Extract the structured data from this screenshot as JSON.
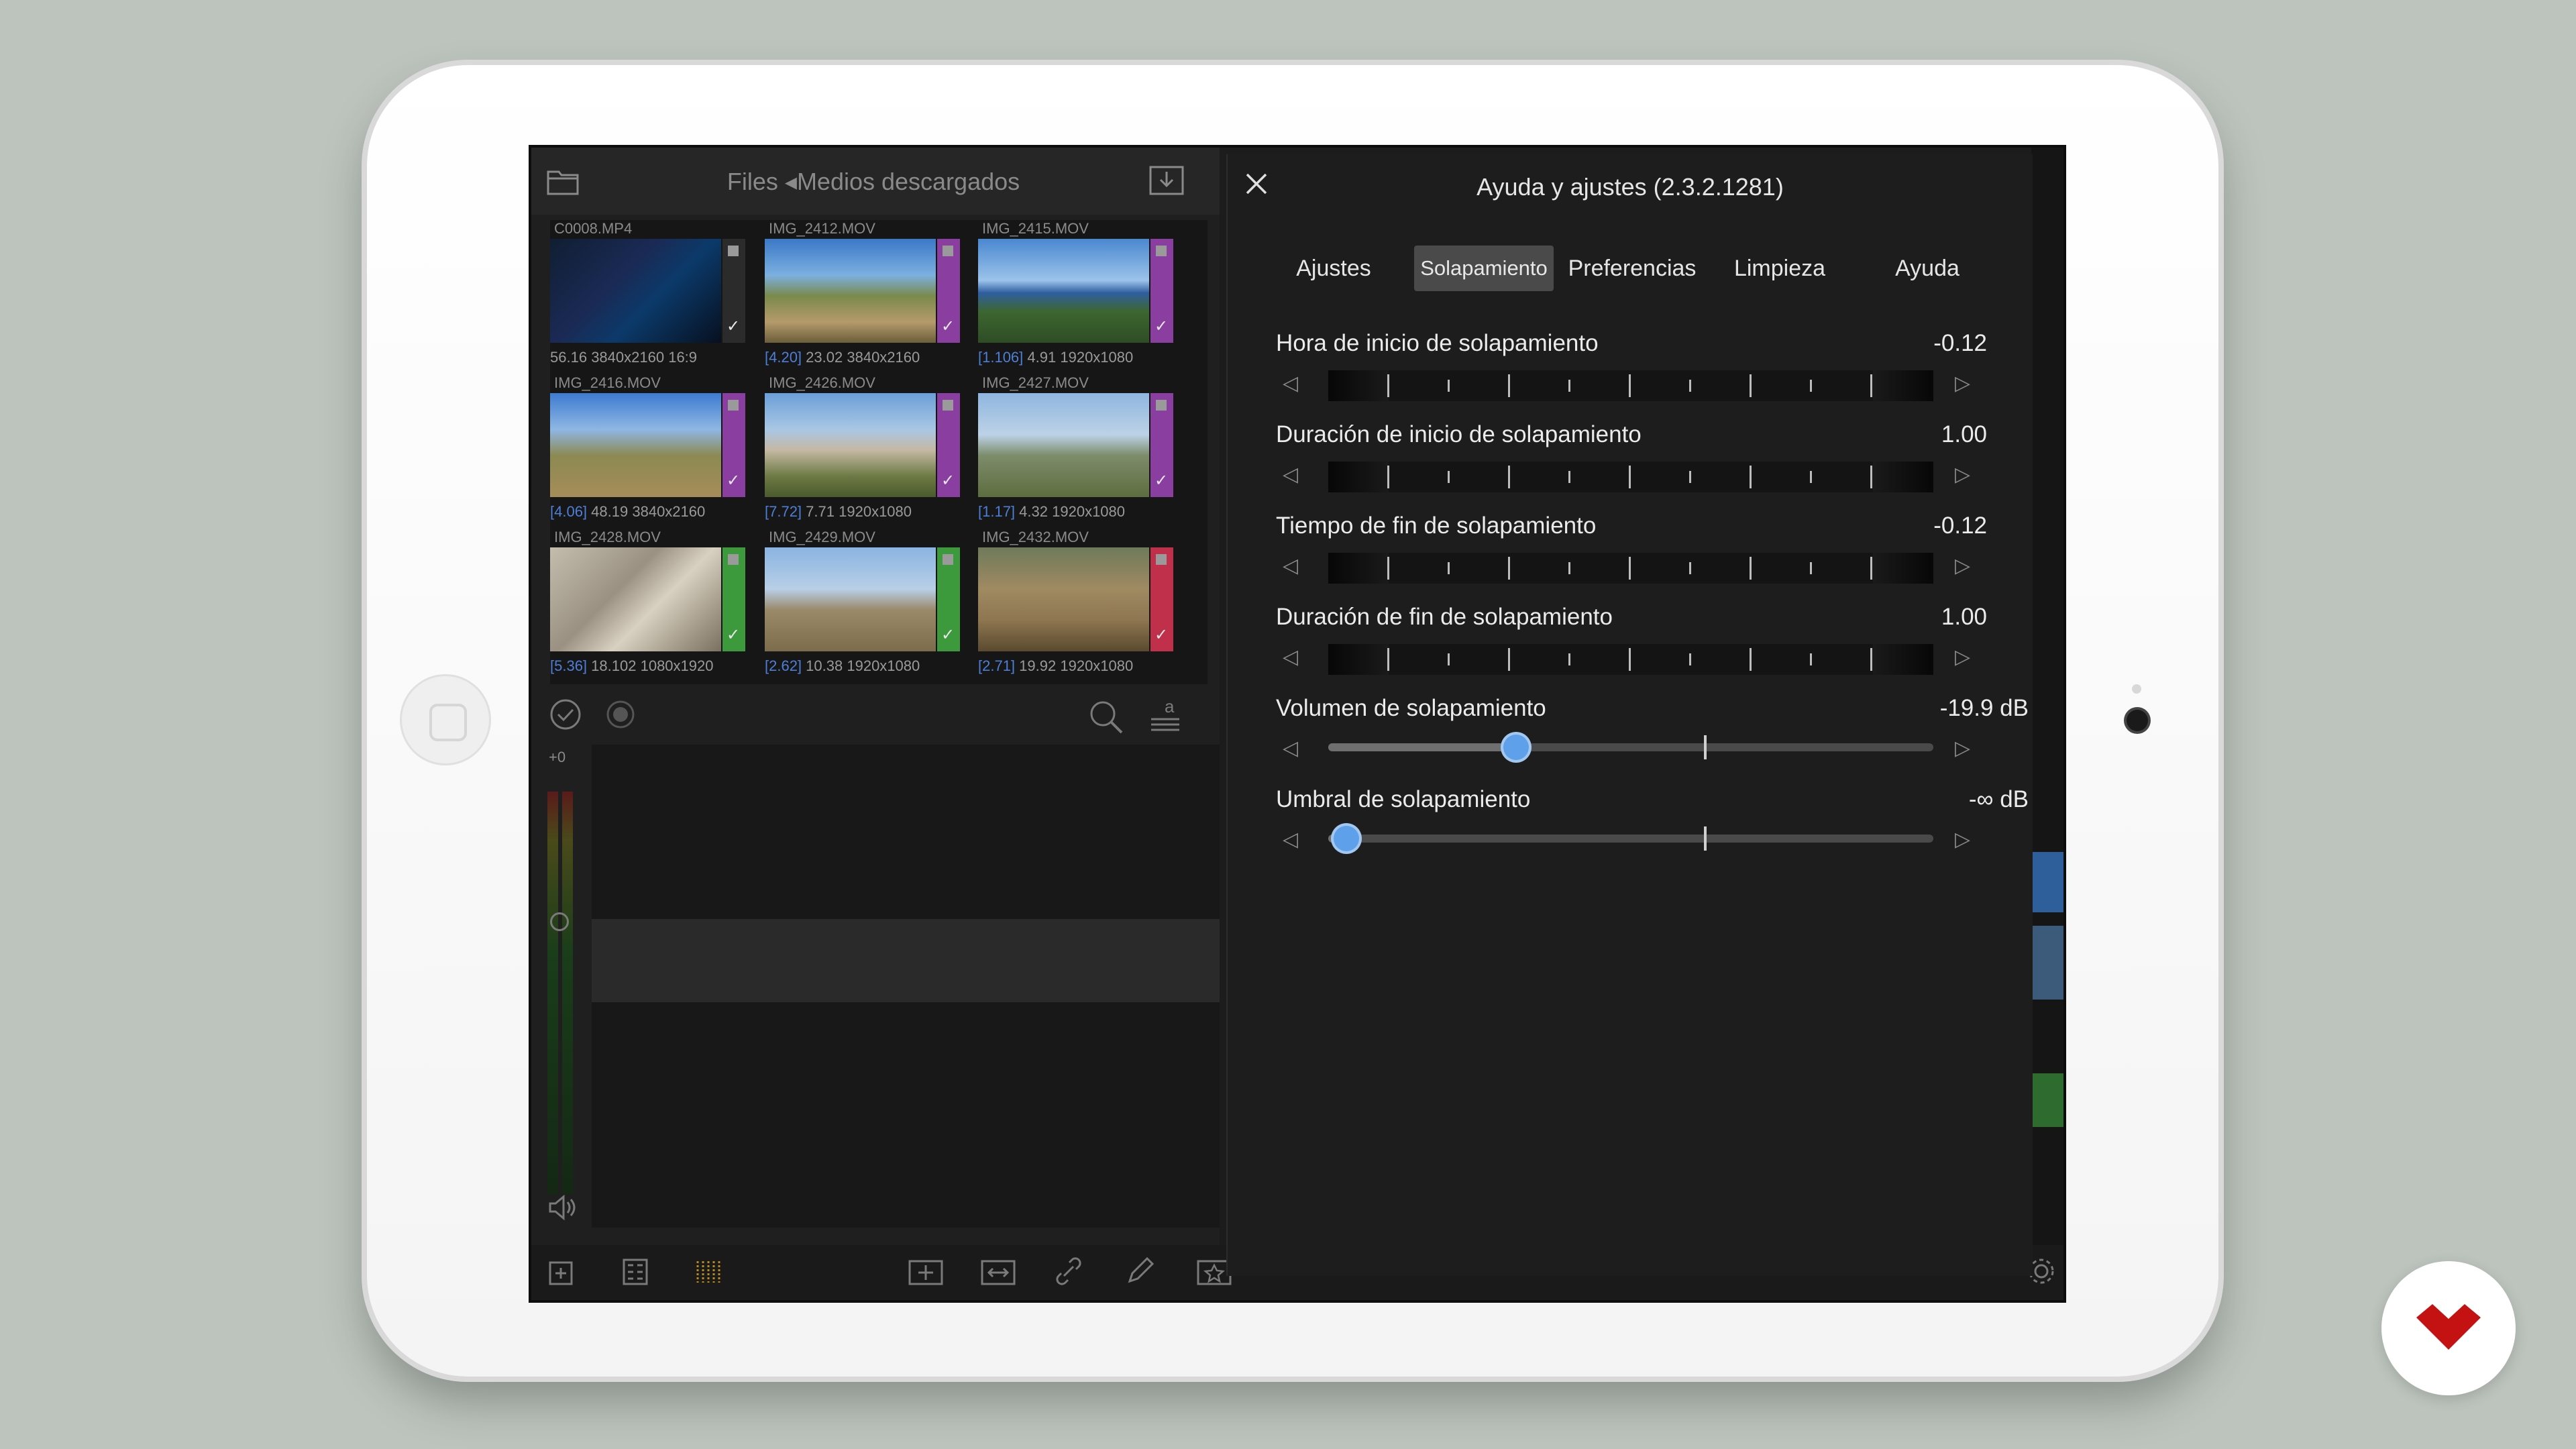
{
  "files_panel": {
    "title": "Files ◂Medios descargados",
    "clips": [
      {
        "name": "C0008.MP4",
        "range": "",
        "duration": "56.16",
        "resolution": "3840x2160",
        "extra": "16:9",
        "tag_color": "#2b2b2b"
      },
      {
        "name": "IMG_2412.MOV",
        "range": "[4.20]",
        "duration": "23.02",
        "resolution": "3840x2160",
        "extra": "",
        "tag_color": "#8a3ea0"
      },
      {
        "name": "IMG_2415.MOV",
        "range": "[1.106]",
        "duration": "4.91",
        "resolution": "1920x1080",
        "extra": "",
        "tag_color": "#8a3ea0"
      },
      {
        "name": "IMG_2416.MOV",
        "range": "[4.06]",
        "duration": "48.19",
        "resolution": "3840x2160",
        "extra": "",
        "tag_color": "#8a3ea0"
      },
      {
        "name": "IMG_2426.MOV",
        "range": "[7.72]",
        "duration": "7.71",
        "resolution": "1920x1080",
        "extra": "",
        "tag_color": "#8a3ea0"
      },
      {
        "name": "IMG_2427.MOV",
        "range": "[1.17]",
        "duration": "4.32",
        "resolution": "1920x1080",
        "extra": "",
        "tag_color": "#8a3ea0"
      },
      {
        "name": "IMG_2428.MOV",
        "range": "[5.36]",
        "duration": "18.102",
        "resolution": "1080x1920",
        "extra": "",
        "tag_color": "#3c9a3c"
      },
      {
        "name": "IMG_2429.MOV",
        "range": "[2.62]",
        "duration": "10.38",
        "resolution": "1920x1080",
        "extra": "",
        "tag_color": "#3c9a3c"
      },
      {
        "name": "IMG_2432.MOV",
        "range": "[2.71]",
        "duration": "19.92",
        "resolution": "1920x1080",
        "extra": "",
        "tag_color": "#c0304a"
      }
    ]
  },
  "timeline": {
    "audio_level_label": "+0"
  },
  "settings_panel": {
    "title": "Ayuda y ajustes (2.3.2.1281)",
    "tabs": [
      {
        "label": "Ajustes",
        "active": false
      },
      {
        "label": "Solapamiento",
        "active": true
      },
      {
        "label": "Preferencias",
        "active": false
      },
      {
        "label": "Limpieza",
        "active": false
      },
      {
        "label": "Ayuda",
        "active": false
      }
    ],
    "settings": [
      {
        "label": "Hora de inicio de solapamiento",
        "value": "-0.12",
        "control": "jog"
      },
      {
        "label": "Duración de inicio de solapamiento",
        "value": "1.00",
        "control": "jog"
      },
      {
        "label": "Tiempo de fin de solapamiento",
        "value": "-0.12",
        "control": "jog"
      },
      {
        "label": "Duración de fin de solapamiento",
        "value": "1.00",
        "control": "jog"
      },
      {
        "label": "Volumen de solapamiento",
        "value": "-19.9 dB",
        "control": "slider",
        "level": 0.31
      },
      {
        "label": "Umbral de solapamiento",
        "value": "-∞ dB",
        "control": "slider",
        "level": 0.03
      }
    ]
  },
  "colors": {
    "accent": "#5ea1ea",
    "logo": "#c41212"
  },
  "icons": [
    "folder-icon",
    "download-icon",
    "check-icon",
    "record-icon",
    "search-icon",
    "text-size-icon",
    "speaker-icon",
    "close-icon",
    "left-arrow-icon",
    "right-arrow-icon",
    "gear-icon"
  ]
}
